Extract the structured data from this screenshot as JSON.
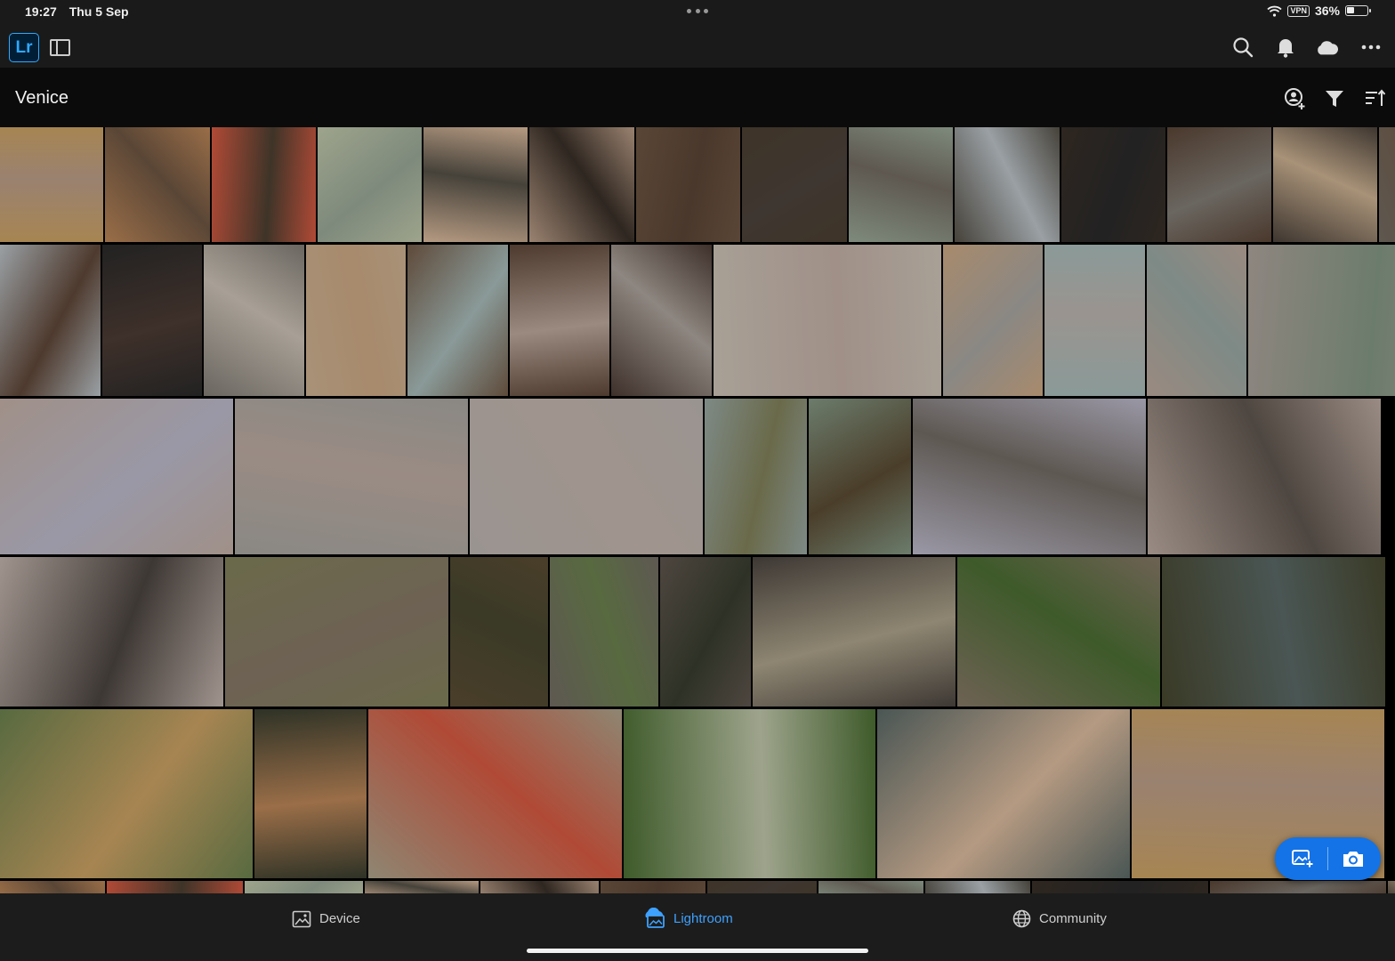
{
  "status_bar": {
    "time": "19:27",
    "date": "Thu 5 Sep",
    "vpn": "VPN",
    "battery": "36%",
    "battery_level": 0.36
  },
  "app": {
    "logo": "Lr"
  },
  "icons": {
    "sidebar": "sidebar-toggle-icon",
    "search": "search-icon",
    "notifications": "bell-icon",
    "cloud": "cloud-icon",
    "more": "more-icon",
    "add_person": "add-person-icon",
    "filter": "filter-icon",
    "sort": "sort-icon",
    "add_photos": "add-photo-icon",
    "camera": "camera-icon"
  },
  "album": {
    "title": "Venice"
  },
  "grid": {
    "photos": [
      {
        "c": "#a78552"
      },
      {
        "c": "#9a6e48"
      },
      {
        "c": "#b04a36"
      },
      {
        "c": "#9ea48c"
      },
      {
        "c": "#b59a82"
      },
      {
        "c": "#9a8270"
      },
      {
        "c": "#5a4636"
      },
      {
        "c": "#3e3428"
      },
      {
        "c": "#7e8a7c"
      },
      {
        "c": "#46423a"
      },
      {
        "c": "#2e2620"
      },
      {
        "c": "#4a382c"
      },
      {
        "c": "#3e3630"
      },
      {
        "c": "#5e5850"
      },
      {
        "c": "#9aa0a4"
      },
      {
        "c": "#222"
      },
      {
        "c": "#6a6660"
      },
      {
        "c": "#a89278"
      },
      {
        "c": "#5e4a3a"
      },
      {
        "c": "#4e3a2e"
      },
      {
        "c": "#3e302a"
      },
      {
        "c": "#a8a096"
      },
      {
        "c": "#a88a6c"
      },
      {
        "c": "#8a9a98"
      },
      {
        "c": "#9a8a80"
      },
      {
        "c": "#8e8680"
      },
      {
        "c": "#a09088"
      },
      {
        "c": "#8a8884"
      },
      {
        "c": "#9a9490"
      },
      {
        "c": "#7e8a86"
      },
      {
        "c": "#6c7c6c"
      },
      {
        "c": "#9a98a6"
      },
      {
        "c": "#9a8c84"
      },
      {
        "c": "#a0948e"
      },
      {
        "c": "#6a6a4a"
      },
      {
        "c": "#4a3e2a"
      },
      {
        "c": "#5e5852"
      },
      {
        "c": "#4e4640"
      },
      {
        "c": "#3e3834"
      },
      {
        "c": "#6e6254"
      },
      {
        "c": "#3a3a26"
      },
      {
        "c": "#586a40"
      },
      {
        "c": "#2e3226"
      },
      {
        "c": "#8e8672"
      },
      {
        "c": "#3e5a2a"
      },
      {
        "c": "#4a5654"
      }
    ]
  },
  "fab": {},
  "tabs": [
    {
      "label": "Device",
      "icon": "photo-icon"
    },
    {
      "label": "Lightroom",
      "icon": "cloud-photo-icon"
    },
    {
      "label": "Community",
      "icon": "globe-icon"
    }
  ]
}
